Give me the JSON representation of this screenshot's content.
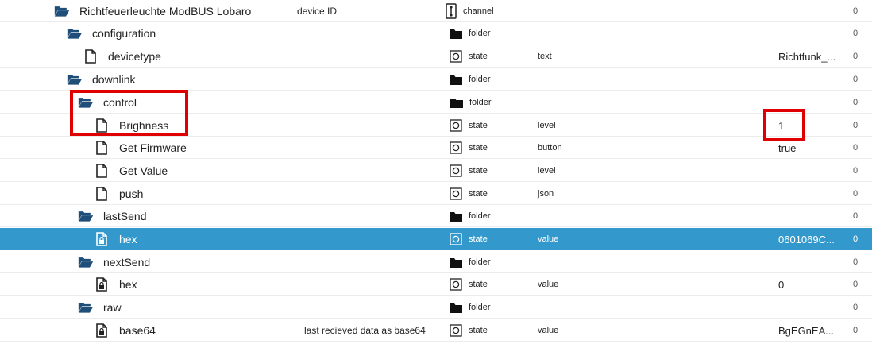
{
  "rows": [
    {
      "name": "Richtfeuerleuchte ModBUS Lobaro",
      "icon": "folder-open-icon",
      "desc": "device ID",
      "type": "channel",
      "role": "",
      "value": "",
      "acl": "0"
    },
    {
      "name": "configuration",
      "icon": "folder-open-icon",
      "desc": "",
      "type": "folder",
      "role": "",
      "value": "",
      "acl": "0"
    },
    {
      "name": "devicetype",
      "icon": "file-icon",
      "desc": "",
      "type": "state",
      "role": "text",
      "value": "Richtfunk_...",
      "acl": "0"
    },
    {
      "name": "downlink",
      "icon": "folder-open-icon",
      "desc": "",
      "type": "folder",
      "role": "",
      "value": "",
      "acl": "0"
    },
    {
      "name": "control",
      "icon": "folder-open-icon",
      "desc": "",
      "type": "folder",
      "role": "",
      "value": "",
      "acl": "0"
    },
    {
      "name": "Brighness",
      "icon": "file-icon",
      "desc": "",
      "type": "state",
      "role": "level",
      "value": "1",
      "acl": "0"
    },
    {
      "name": "Get Firmware",
      "icon": "file-icon",
      "desc": "",
      "type": "state",
      "role": "button",
      "value": "true",
      "acl": "0"
    },
    {
      "name": "Get Value",
      "icon": "file-icon",
      "desc": "",
      "type": "state",
      "role": "level",
      "value": "",
      "acl": "0"
    },
    {
      "name": "push",
      "icon": "file-icon",
      "desc": "",
      "type": "state",
      "role": "json",
      "value": "",
      "acl": "0"
    },
    {
      "name": "lastSend",
      "icon": "folder-open-icon",
      "desc": "",
      "type": "folder",
      "role": "",
      "value": "",
      "acl": "0"
    },
    {
      "name": "hex",
      "icon": "locked-file-icon",
      "desc": "",
      "type": "state",
      "role": "value",
      "value": "0601069C...",
      "acl": "0",
      "selected": true
    },
    {
      "name": "nextSend",
      "icon": "folder-open-icon",
      "desc": "",
      "type": "folder",
      "role": "",
      "value": "",
      "acl": "0"
    },
    {
      "name": "hex",
      "icon": "locked-file-icon",
      "desc": "",
      "type": "state",
      "role": "value",
      "value": "0",
      "acl": "0"
    },
    {
      "name": "raw",
      "icon": "folder-open-icon",
      "desc": "",
      "type": "folder",
      "role": "",
      "value": "",
      "acl": "0"
    },
    {
      "name": "base64",
      "icon": "locked-file-icon",
      "desc": "last recieved data as base64",
      "type": "state",
      "role": "value",
      "value": "BgEGnEA...",
      "acl": "0"
    }
  ],
  "colors": {
    "selected_row": "#3399cc",
    "folder": "#1f4e79",
    "highlight": "#e00000"
  }
}
